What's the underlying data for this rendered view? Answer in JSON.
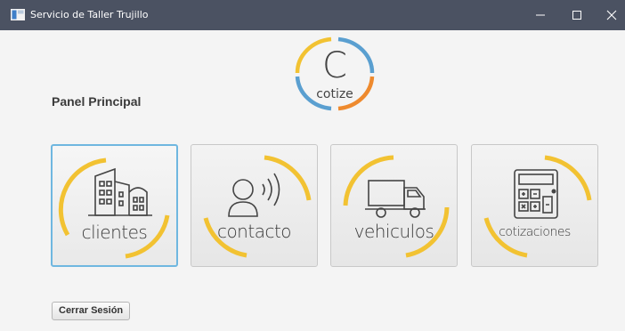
{
  "window": {
    "title": "Servicio de Taller Trujillo",
    "controls": [
      "minimize",
      "maximize",
      "close"
    ]
  },
  "logo": {
    "letter": "C",
    "wordmark": "cotize",
    "colors": [
      "#f2c232",
      "#5a9fd0",
      "#ee8a2e"
    ]
  },
  "panel": {
    "title": "Panel Principal"
  },
  "tiles": [
    {
      "label": "clientes",
      "icon": "buildings-icon",
      "focused": true
    },
    {
      "label": "contacto",
      "icon": "person-sound-icon",
      "focused": false
    },
    {
      "label": "vehiculos",
      "icon": "truck-icon",
      "focused": false
    },
    {
      "label": "cotizaciones",
      "icon": "calculator-icon",
      "focused": false
    }
  ],
  "logout": {
    "label": "Cerrar Sesión"
  },
  "colors": {
    "titlebar": "#4b5262",
    "accent_yellow": "#f2c232",
    "focus_border": "#6fb7e0"
  }
}
